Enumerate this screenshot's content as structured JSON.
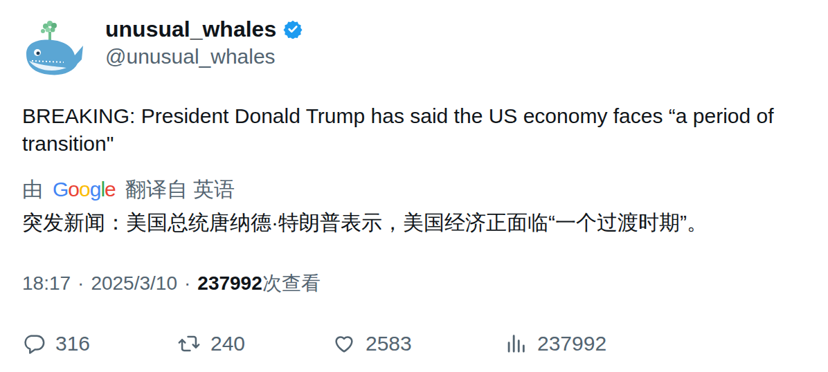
{
  "account": {
    "name": "unusual_whales",
    "handle": "@unusual_whales",
    "verified": true
  },
  "text": "BREAKING: President Donald Trump has said the US economy faces “a period of transition\"",
  "translation": {
    "prefix": "由",
    "provider": "Google",
    "suffix": "翻译自 英语",
    "text": "突发新闻：美国总统唐纳德·特朗普表示，美国经济正面临“一个过渡时期”。"
  },
  "meta": {
    "time": "18:17",
    "separator": "·",
    "date": "2025/3/10",
    "views": "237992",
    "views_label": "次查看"
  },
  "actions": [
    {
      "kind": "reply",
      "count": "316"
    },
    {
      "kind": "retweet",
      "count": "240"
    },
    {
      "kind": "like",
      "count": "2583"
    },
    {
      "kind": "views",
      "count": "237992"
    }
  ]
}
